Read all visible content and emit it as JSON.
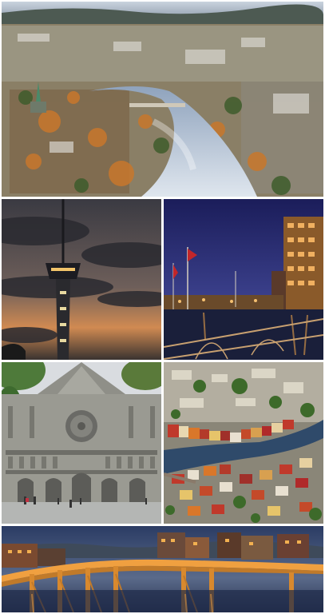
{
  "collage": {
    "tiles": [
      {
        "id": "aerial-river-city",
        "dominant_colors": [
          "#7f8aa0",
          "#c47a2a",
          "#3d5d2a",
          "#d9dde4"
        ]
      },
      {
        "id": "tv-tower-dusk",
        "dominant_colors": [
          "#2a2a33",
          "#d9894a",
          "#5a5a66"
        ]
      },
      {
        "id": "harbor-night",
        "dominant_colors": [
          "#1b1f5a",
          "#e59a3a",
          "#c23a2a"
        ]
      },
      {
        "id": "cathedral-facade",
        "dominant_colors": [
          "#8f8f8a",
          "#b8b8b0",
          "#6a6a64"
        ]
      },
      {
        "id": "colorful-riverside-houses",
        "dominant_colors": [
          "#c44a2a",
          "#3d6a2a",
          "#e6dcc8"
        ]
      },
      {
        "id": "lit-bridge-dusk",
        "dominant_colors": [
          "#2b3c64",
          "#f0a040",
          "#5a4a3a"
        ]
      }
    ]
  }
}
